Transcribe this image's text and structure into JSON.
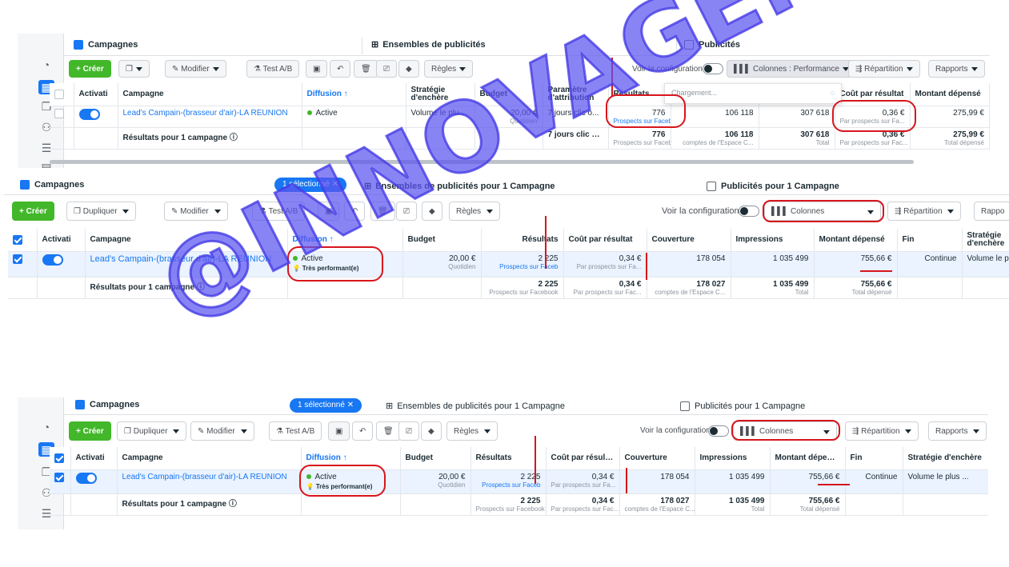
{
  "watermark": "@INNOVAGENCY",
  "shot1": {
    "tabs": {
      "campaigns": "Campagnes",
      "adsets": "Ensembles de publicités",
      "ads": "Publicités"
    },
    "toolbar": {
      "create": "+ Créer",
      "edit": "Modifier",
      "abtest": "Test A/B",
      "rules": "Règles",
      "config": "Voir la configuration",
      "columns": "Colonnes : Performance",
      "breakdown": "Répartition",
      "reports": "Rapports"
    },
    "loading": "Chargement...",
    "headers": [
      "Activati",
      "Campagne",
      "Diffusion ↑",
      "Stratégie d'enchère",
      "Budget",
      "Paramètre d'attribution",
      "Résultats",
      "",
      "Coût par résultat",
      "Montant dépensé"
    ],
    "row": {
      "name": "Lead's Campain-(brasseur d'air)-LA REUNION",
      "status": "Active",
      "strategy": "Volume le plus ...",
      "budget": "20,00 €",
      "budget_sub": "Quotidien",
      "attribution": "7 jours clic o...",
      "results": "776",
      "results_sub": "Prospects sur Faceb",
      "reach": "106 118",
      "impr": "307 618",
      "cpr": "0,36 €",
      "cpr_sub": "Par prospects sur Fa...",
      "spent": "275,99 €"
    },
    "total": {
      "label": "Résultats pour 1 campagne",
      "attribution": "7 jours clic ou ...",
      "results": "776",
      "results_sub": "Prospects sur Facebook",
      "reach": "106 118",
      "reach_sub": "comptes de l'Espace C...",
      "impr": "307 618",
      "impr_sub": "Total",
      "cpr": "0,36 €",
      "cpr_sub": "Par prospects sur Fac...",
      "spent": "275,99 €",
      "spent_sub": "Total dépensé"
    }
  },
  "shot2": {
    "tabs": {
      "campaigns": "Campagnes",
      "selected": "1 sélectionné ✕",
      "adsets": "Ensembles de publicités pour 1 Campagne",
      "ads": "Publicités pour 1 Campagne"
    },
    "toolbar": {
      "create": "+ Créer",
      "duplicate": "Dupliquer",
      "edit": "Modifier",
      "abtest": "Test A/B",
      "rules": "Règles",
      "config": "Voir la configuration",
      "columns": "Colonnes",
      "breakdown": "Répartition",
      "reports": "Rappo"
    },
    "headers": [
      "Activati",
      "Campagne",
      "Diffusion ↑",
      "Budget",
      "Résultats",
      "Coût par résultat",
      "Couverture",
      "Impressions",
      "Montant dépensé",
      "Fin",
      "Stratégie d'enchère"
    ],
    "row": {
      "name": "Lead's Campain-(brasseur d'air)-LA REUNION",
      "status": "Active",
      "perf": "Très performant(e)",
      "budget": "20,00 €",
      "budget_sub": "Quotidien",
      "results": "2 225",
      "results_sub": "Prospects sur Faceb",
      "cpr": "0,34 €",
      "cpr_sub": "Par prospects sur Fa...",
      "reach": "178 054",
      "impr": "1 035 499",
      "spent": "755,66 €",
      "end": "Continue",
      "strategy": "Volume le p"
    },
    "total": {
      "label": "Résultats pour 1 campagne",
      "results": "2 225",
      "results_sub": "Prospects sur Facebook",
      "cpr": "0,34 €",
      "cpr_sub": "Par prospects sur Fac...",
      "reach": "178 027",
      "reach_sub": "comptes de l'Espace C...",
      "impr": "1 035 499",
      "impr_sub": "Total",
      "spent": "755,66 €",
      "spent_sub": "Total dépensé"
    }
  },
  "shot3": {
    "tabs": {
      "campaigns": "Campagnes",
      "selected": "1 sélectionné ✕",
      "adsets": "Ensembles de publicités pour 1 Campagne",
      "ads": "Publicités pour 1 Campagne"
    },
    "toolbar": {
      "create": "+ Créer",
      "duplicate": "Dupliquer",
      "edit": "Modifier",
      "abtest": "Test A/B",
      "rules": "Règles",
      "config": "Voir la configuration",
      "columns": "Colonnes",
      "breakdown": "Répartition",
      "reports": "Rapports"
    },
    "headers": [
      "Activati",
      "Campagne",
      "Diffusion ↑",
      "Budget",
      "Résultats",
      "Coût par résultat",
      "Couverture",
      "Impressions",
      "Montant dépensé",
      "Fin",
      "Stratégie d'enchère"
    ],
    "row": {
      "name": "Lead's Campain-(brasseur d'air)-LA REUNION",
      "status": "Active",
      "perf": "Très performant(e)",
      "budget": "20,00 €",
      "budget_sub": "Quotidien",
      "results": "2 225",
      "results_sub": "Prospects sur Faceb",
      "cpr": "0,34 €",
      "cpr_sub": "Par prospects sur Fa...",
      "reach": "178 054",
      "impr": "1 035 499",
      "spent": "755,66 €",
      "end": "Continue",
      "strategy": "Volume le plus ..."
    },
    "total": {
      "label": "Résultats pour 1 campagne",
      "results": "2 225",
      "results_sub": "Prospects sur Facebook",
      "cpr": "0,34 €",
      "cpr_sub": "Par prospects sur Fac...",
      "reach": "178 027",
      "reach_sub": "comptes de l'Espace C...",
      "impr": "1 035 499",
      "impr_sub": "Total",
      "spent": "755,66 €",
      "spent_sub": "Total dépensé"
    }
  },
  "colors": {
    "accent": "#1877f2",
    "create": "#42b72a",
    "annotation": "#d8151c",
    "watermark": "#5c54f0"
  }
}
